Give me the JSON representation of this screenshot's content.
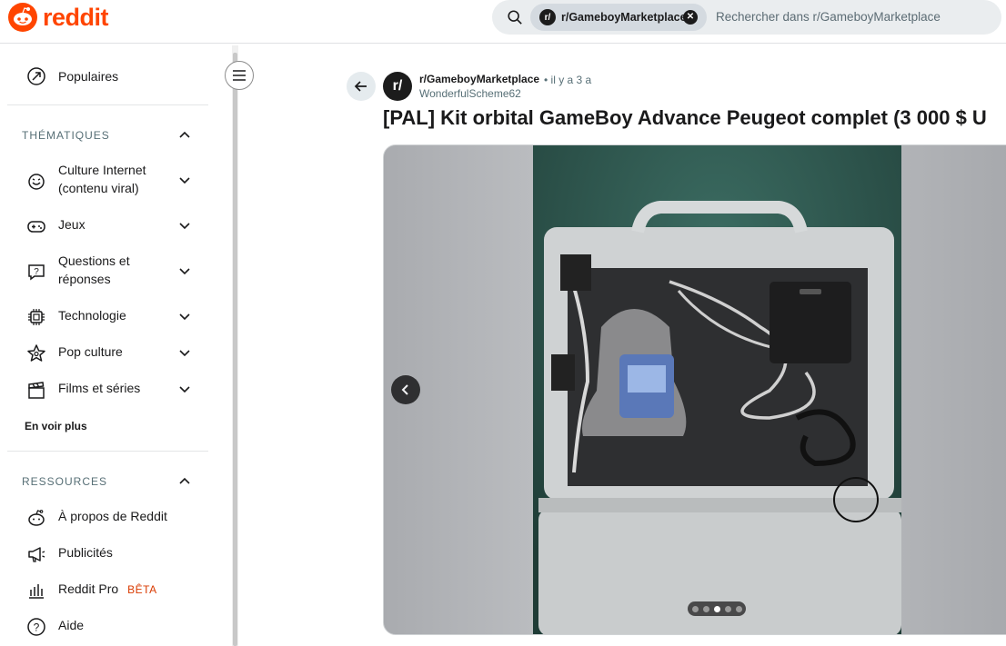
{
  "header": {
    "logo_text": "reddit",
    "search": {
      "chip_label": "r/GameboyMarketplace",
      "chip_avatar": "r/",
      "placeholder": "Rechercher dans r/GameboyMarketplace"
    }
  },
  "sidebar": {
    "top_items": [
      {
        "label": "Populaires",
        "icon": "popular-icon"
      }
    ],
    "thematiques": {
      "title": "THÉMATIQUES",
      "items": [
        {
          "label": "Culture Internet",
          "label2": "(contenu viral)",
          "icon": "internet-culture-icon"
        },
        {
          "label": "Jeux",
          "icon": "gamepad-icon"
        },
        {
          "label": "Questions et",
          "label2": "réponses",
          "icon": "question-bubble-icon"
        },
        {
          "label": "Technologie",
          "icon": "chip-icon"
        },
        {
          "label": "Pop culture",
          "icon": "star-icon"
        },
        {
          "label": "Films et séries",
          "icon": "clapperboard-icon"
        }
      ],
      "see_more": "En voir plus"
    },
    "ressources": {
      "title": "RESSOURCES",
      "items": [
        {
          "label": "À propos de Reddit",
          "icon": "reddit-icon"
        },
        {
          "label": "Publicités",
          "icon": "megaphone-icon"
        },
        {
          "label": "Reddit Pro",
          "badge": "BÊTA",
          "icon": "bar-chart-icon"
        },
        {
          "label": "Aide",
          "icon": "help-icon"
        }
      ]
    }
  },
  "post": {
    "subreddit": "r/GameboyMarketplace",
    "subreddit_avatar": "r/",
    "time": "• il y a 3 a",
    "author": "WonderfulScheme62",
    "title": "[PAL] Kit orbital GameBoy Advance Peugeot complet (3 000 $ U",
    "gallery": {
      "image_count": 5,
      "current_index": 3
    }
  }
}
